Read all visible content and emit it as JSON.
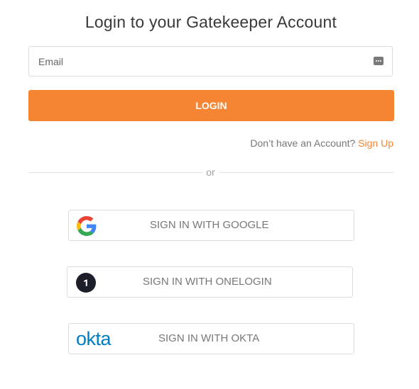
{
  "page": {
    "title": "Login to your Gatekeeper Account"
  },
  "form": {
    "email_placeholder": "Email",
    "email_value": "",
    "login_label": "LOGIN",
    "password_manager_icon": "password-manager-icon"
  },
  "signup": {
    "prompt": "Don’t have an Account? ",
    "link_label": "Sign Up"
  },
  "divider": {
    "text": "or"
  },
  "sso": [
    {
      "label": "SIGN IN WITH GOOGLE",
      "icon": "google-logo-icon"
    },
    {
      "label": "SIGN IN WITH ONELOGIN",
      "icon": "onelogin-logo-icon"
    },
    {
      "label": "SIGN IN WITH OKTA",
      "icon": "okta-logo-icon",
      "logo_text": "okta"
    }
  ],
  "colors": {
    "accent": "#f58533",
    "text": "#3a3a3a",
    "muted": "#777777",
    "border": "#dcdcdc",
    "okta_blue": "#007dc1",
    "google_blue": "#4285f4",
    "google_red": "#ea4335",
    "google_yellow": "#fbbc05",
    "google_green": "#34a853"
  }
}
